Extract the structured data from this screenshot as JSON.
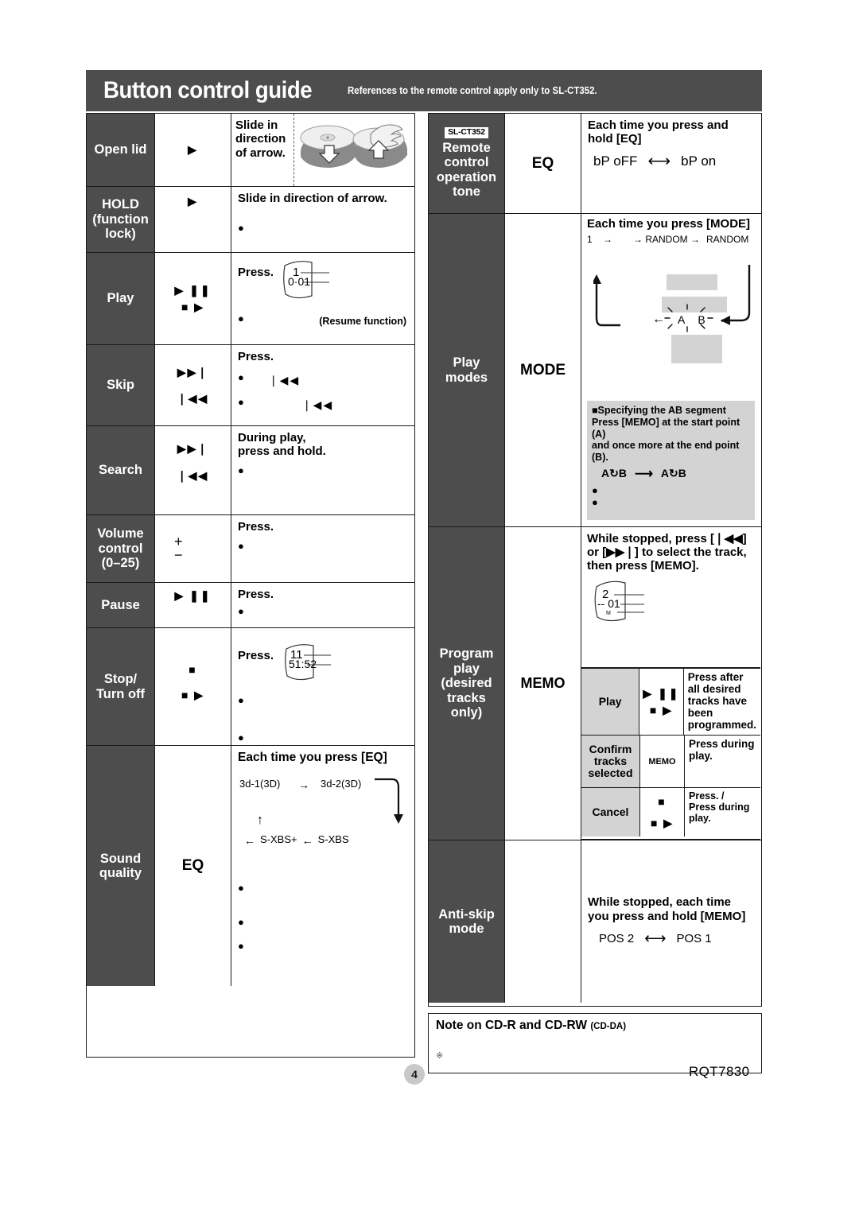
{
  "header": {
    "title": "Button control guide",
    "subtitle": "References to the remote control apply only to SL-CT352."
  },
  "left_table": {
    "rows": [
      {
        "label": "Open lid",
        "button_glyphs": [
          "▶"
        ],
        "desc_heading": "Slide in direction of arrow.",
        "has_disc_images": true
      },
      {
        "label": "HOLD (function lock)",
        "label_lines": [
          "HOLD",
          "(function",
          "lock)"
        ],
        "button_glyphs": [
          "▶"
        ],
        "desc_heading": "Slide in direction of arrow.",
        "bullets": [
          ""
        ]
      },
      {
        "label": "Play",
        "button_glyphs": [
          "▶ ❚❚",
          "■ ▶"
        ],
        "desc_heading": "Press.",
        "lcd": {
          "line1": "1",
          "line2": "0·01"
        },
        "bullets": [
          ""
        ],
        "note": "(Resume function)"
      },
      {
        "label": "Skip",
        "button_glyphs": [
          "▶▶❘",
          "❘◀◀"
        ],
        "desc_heading": "Press.",
        "bullets": [
          "❘◀◀",
          "❘◀◀"
        ]
      },
      {
        "label": "Search",
        "button_glyphs": [
          "▶▶❘",
          "❘◀◀"
        ],
        "desc_heading": "During play,\npress and hold.",
        "bullets": [
          ""
        ]
      },
      {
        "label": "Volume control (0–25)",
        "label_lines": [
          "Volume",
          "control",
          "(0–25)"
        ],
        "button_glyphs": [
          "+",
          "−"
        ],
        "desc_heading": "Press.",
        "bullets": [
          ""
        ]
      },
      {
        "label": "Pause",
        "button_glyphs": [
          "▶ ❚❚"
        ],
        "desc_heading": "Press.",
        "bullets": [
          ""
        ]
      },
      {
        "label": "Stop/ Turn off",
        "label_lines": [
          "Stop/",
          "Turn off"
        ],
        "button_glyphs": [
          "■",
          "■ ▶"
        ],
        "desc_heading": "Press.",
        "lcd": {
          "line1": "11",
          "line2": "51:52"
        },
        "bullets": [
          "",
          ""
        ]
      },
      {
        "label": "Sound quality",
        "label_lines": [
          "Sound",
          "quality"
        ],
        "button_glyphs": [
          "EQ"
        ],
        "desc_heading": "Each time you press [EQ]",
        "eq_flow": {
          "top_left": "3d-1(3D)",
          "top_arrow": "→",
          "top_right": "3d-2(3D)",
          "bottom_left_arrow": "←",
          "bottom_mid": "S-XBS+",
          "bottom_arrow2": "←",
          "bottom_right": "S-XBS",
          "up_arrow": "↑"
        },
        "bullets": [
          "",
          "",
          ""
        ]
      }
    ]
  },
  "right_table": {
    "rows": [
      {
        "chip": "SL-CT352",
        "label_lines": [
          "Remote",
          "control",
          "operation",
          "tone"
        ],
        "button_glyphs": [
          "EQ"
        ],
        "desc_heading": "Each time you press and hold [EQ]",
        "toggle": {
          "left": "bP oFF",
          "arrow": "⟷",
          "right": "bP on"
        }
      },
      {
        "label_lines": [
          "Play",
          "modes"
        ],
        "button_glyphs": [
          "MODE"
        ],
        "desc_heading": "Each time you press [MODE]",
        "mode_flow": {
          "items": [
            "1",
            "→",
            "→ RANDOM →",
            "RANDOM"
          ],
          "ab_left": "A",
          "ab_right": "B"
        },
        "ab_note": {
          "title": "■Specifying the AB segment",
          "line1": "Press [MEMO] at the start point (A)",
          "line2": "and once more at the end point (B).",
          "flow_left": "A↻B",
          "flow_arrow": "⟶",
          "flow_right": "A↻B",
          "bullets": [
            "",
            ""
          ]
        }
      },
      {
        "label_lines": [
          "Program",
          "play",
          "(desired",
          "tracks",
          "only)"
        ],
        "button_glyphs": [
          "MEMO"
        ],
        "desc_heading": "While stopped, press [❘◀◀] or [▶▶❘] to select the track, then press [MEMO].",
        "lcd": {
          "line1": "2",
          "line2": "-- 01"
        },
        "inner_rows": [
          {
            "label": "Play",
            "glyphs": [
              "▶ ❚❚",
              "■ ▶"
            ],
            "text": "Press after all desired tracks have been programmed."
          },
          {
            "label_lines": [
              "Confirm",
              "tracks",
              "selected"
            ],
            "glyphs": [
              "MEMO"
            ],
            "glyph_small": true,
            "text": "Press during play."
          },
          {
            "label": "Cancel",
            "glyphs": [
              "■",
              "■ ▶"
            ],
            "text": "Press.                 /\nPress during play."
          }
        ]
      },
      {
        "label_lines": [
          "Anti-skip",
          "mode"
        ],
        "button_glyphs": [],
        "desc_heading": "While stopped, each time you press and hold [MEMO]",
        "toggle": {
          "left": "POS 2",
          "arrow": "⟷",
          "right": "POS 1"
        }
      }
    ]
  },
  "note_box": {
    "title": "Note on CD-R and CD-RW",
    "title_small": "(CD-DA)",
    "mark": "※"
  },
  "footer": {
    "page_number": "4",
    "doc_code": "RQT7830"
  },
  "colors": {
    "label_bg": "#4d4d4d",
    "inner_label_bg": "#d3d3d3",
    "border": "#1a1a1a",
    "page_badge": "#c9c9c9"
  }
}
